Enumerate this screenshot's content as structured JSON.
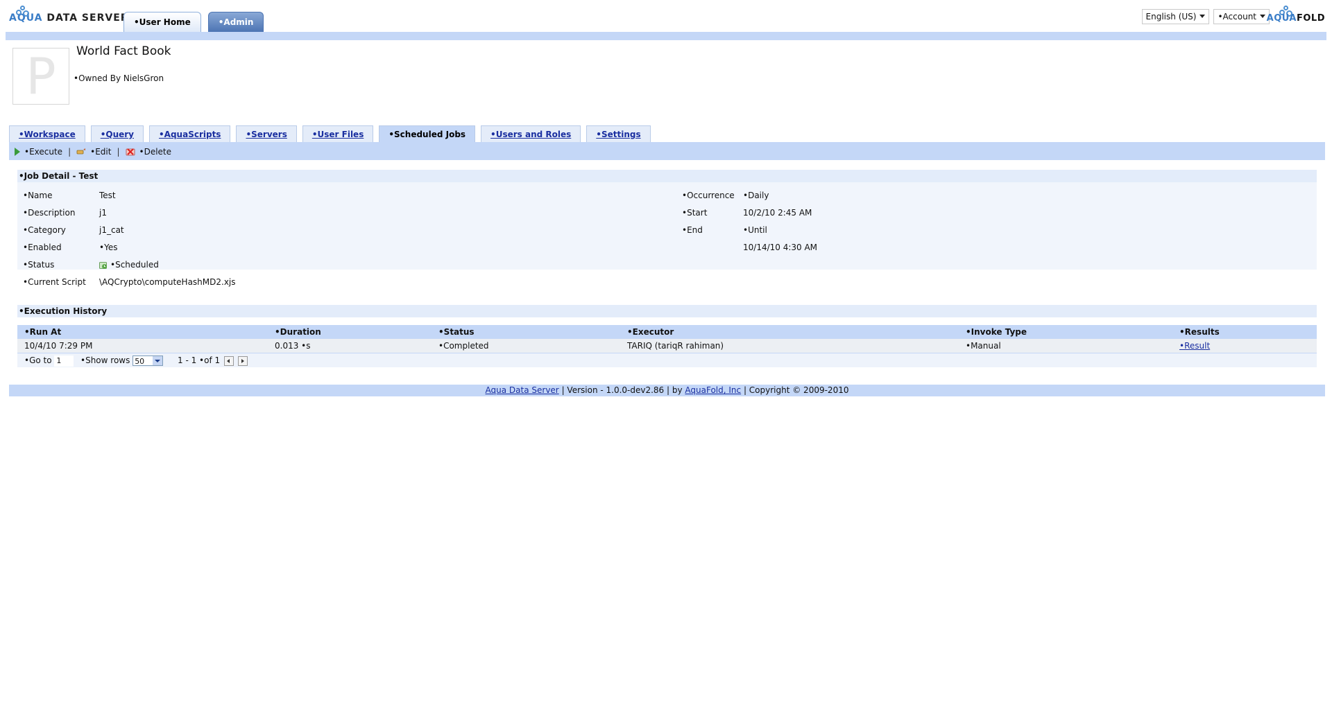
{
  "header": {
    "logo_aqua": "AQUA",
    "logo_rest": " DATA SERVER",
    "tabs": [
      {
        "label": "•User Home"
      },
      {
        "label": "•Admin"
      }
    ],
    "language": "English (US)",
    "account": "•Account",
    "right_logo_aqua": "AQUA",
    "right_logo_rest": "FOLD"
  },
  "project": {
    "icon_letter": "P",
    "title": "World Fact Book",
    "owner": "•Owned By NielsGron"
  },
  "sub_tabs": [
    {
      "label": "•Workspace"
    },
    {
      "label": "•Query"
    },
    {
      "label": "•AquaScripts"
    },
    {
      "label": "•Servers"
    },
    {
      "label": "•User Files"
    },
    {
      "label": "•Scheduled Jobs"
    },
    {
      "label": "•Users and Roles"
    },
    {
      "label": "•Settings"
    }
  ],
  "toolbar": {
    "execute": "•Execute",
    "edit": "•Edit",
    "delete": "•Delete",
    "sep": "|"
  },
  "job_detail": {
    "title": "•Job Detail - Test",
    "left": [
      {
        "label": "•Name",
        "value": "Test"
      },
      {
        "label": "•Description",
        "value": "j1"
      },
      {
        "label": "•Category",
        "value": "j1_cat"
      },
      {
        "label": "•Enabled",
        "value": "•Yes"
      },
      {
        "label": "•Status",
        "value": "•Scheduled"
      },
      {
        "label": "•Current Script",
        "value": "\\AQCrypto\\computeHashMD2.xjs"
      }
    ],
    "right": [
      {
        "label": "•Occurrence",
        "value": "•Daily"
      },
      {
        "label": "•Start",
        "value": "10/2/10 2:45 AM"
      },
      {
        "label": "•End",
        "value": "•Until"
      },
      {
        "label": "",
        "value": "10/14/10 4:30 AM"
      }
    ]
  },
  "history": {
    "title": "•Execution History",
    "columns": [
      "•Run At",
      "•Duration",
      "•Status",
      "•Executor",
      "•Invoke Type",
      "•Results"
    ],
    "rows": [
      [
        "10/4/10 7:29 PM",
        "0.013 •s",
        "•Completed",
        "TARIQ (tariqR rahiman)",
        "•Manual",
        "•Result"
      ]
    ],
    "goto_label": "•Go to",
    "goto_value": "1",
    "show_rows_label": "•Show rows",
    "show_rows_value": "50",
    "paging": "1 - 1 •of 1"
  },
  "footer": {
    "link1": "Aqua Data Server",
    "middle": " | Version - 1.0.0-dev2.86 | by ",
    "link2": "AquaFold, Inc",
    "end": " | Copyright © 2009-2010"
  }
}
